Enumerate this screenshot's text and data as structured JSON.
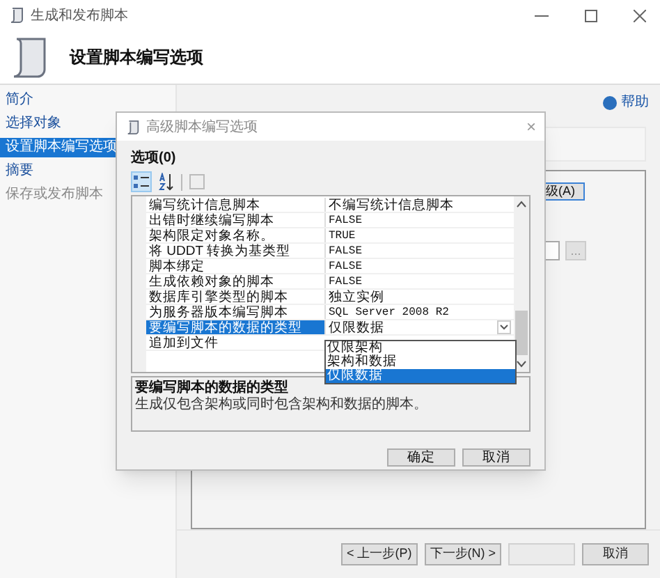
{
  "window": {
    "title": "生成和发布脚本"
  },
  "header": {
    "title": "设置脚本编写选项"
  },
  "sidebar": {
    "items": [
      {
        "label": "简介",
        "selected": false,
        "disabled": false
      },
      {
        "label": "选择对象",
        "selected": false,
        "disabled": false
      },
      {
        "label": "设置脚本编写选项",
        "selected": true,
        "disabled": false
      },
      {
        "label": "摘要",
        "selected": false,
        "disabled": false
      },
      {
        "label": "保存或发布脚本",
        "selected": false,
        "disabled": true
      }
    ]
  },
  "help_link": "帮助",
  "main": {
    "advanced_button": "级(A)",
    "browse_button": "..."
  },
  "wizard_buttons": [
    {
      "label": "< 上一步(P)",
      "disabled": false
    },
    {
      "label": "下一步(N) >",
      "disabled": false
    },
    {
      "disabled": true
    },
    {
      "label": "取消",
      "disabled": false
    }
  ],
  "dialog": {
    "title": "高级脚本编写选项",
    "close": "×",
    "heading": "选项(0)",
    "toolbar": [
      {
        "kind": "categorized",
        "selected": true
      },
      {
        "kind": "alphabetical",
        "selected": false
      },
      {
        "kind": "pages",
        "selected": false
      }
    ],
    "rows": [
      {
        "name": "编写统计信息脚本",
        "value": "不编写统计信息脚本",
        "selected": false
      },
      {
        "name": "出错时继续编写脚本",
        "value": "FALSE",
        "selected": false
      },
      {
        "name": "架构限定对象名称。",
        "value": "TRUE",
        "selected": false
      },
      {
        "name": "将 UDDT 转换为基类型",
        "value": "FALSE",
        "selected": false
      },
      {
        "name": "脚本绑定",
        "value": "FALSE",
        "selected": false
      },
      {
        "name": "生成依赖对象的脚本",
        "value": "FALSE",
        "selected": false
      },
      {
        "name": "数据库引擎类型的脚本",
        "value": "独立实例",
        "selected": false
      },
      {
        "name": "为服务器版本编写脚本",
        "value": "SQL Server 2008 R2",
        "selected": false
      },
      {
        "name": "要编写脚本的数据的类型",
        "value": "仅限数据",
        "selected": true
      },
      {
        "name": "追加到文件",
        "selected": false
      }
    ],
    "dropdown": [
      {
        "label": "仅限架构",
        "selected": false
      },
      {
        "label": "架构和数据",
        "selected": false
      },
      {
        "label": "仅限数据",
        "selected": true
      }
    ],
    "description": {
      "title": "要编写脚本的数据的类型",
      "text": "生成仅包含架构或同时包含架构和数据的脚本。"
    },
    "buttons": [
      "确定",
      "取消"
    ]
  }
}
